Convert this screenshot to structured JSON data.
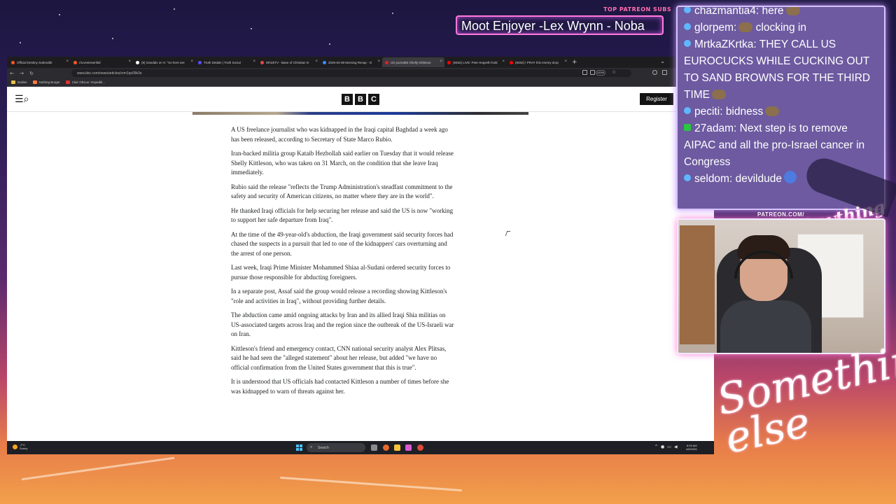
{
  "overlay": {
    "patreon_heading": "TOP PATREON SUBS",
    "patreon_ticker": "Moot Enjoyer -Lex Wrynn -  Noba",
    "patreon_url": "PATREON.COM/",
    "patreon_signature": "Anything else",
    "big_signature": "Something else"
  },
  "browser": {
    "tabs": [
      {
        "label": "Official Destiny Subreddit",
        "color": "#ff5722"
      },
      {
        "label": "r/Livestreamfail",
        "color": "#ff5722"
      },
      {
        "label": "(9) Gandalv on X: \"So here are",
        "color": "#ffffff"
      },
      {
        "label": "Truth Details | Truth Social",
        "color": "#5b4bff"
      },
      {
        "label": "WhickTV - Bane of Christian N",
        "color": "#e04a4a"
      },
      {
        "label": "2026-04-08 Morning Recap - G",
        "color": "#3d8bfd"
      },
      {
        "label": "US journalist Shelly Kittleson",
        "color": "#d22"
      },
      {
        "label": "(8452) LIVE: Pete Hegseth hold",
        "color": "#ff0000"
      },
      {
        "label": "(8452) I PRAY this enemy drop",
        "color": "#ff0000"
      }
    ],
    "url": "www.bbc.com/news/articles/crm1qx09k3o",
    "zoom": "120%",
    "bookmarks": [
      {
        "label": "Dailies",
        "color": "#e8c34a"
      },
      {
        "label": "Nothing Burger",
        "color": "#ff7a3d"
      },
      {
        "label": "Clair Obscur: Expediti...",
        "color": "#e03030"
      }
    ]
  },
  "bbc": {
    "logo": [
      "B",
      "B",
      "C"
    ],
    "register": "Register",
    "menu_icon": "☰",
    "search_icon": "⌕",
    "paragraphs": [
      "A US freelance journalist who was kidnapped in the Iraqi capital Baghdad a week ago has been released, according to Secretary of State Marco Rubio.",
      "Iran-backed militia group Kataib Hezbollah said earlier on Tuesday that it would release Shelly Kittleson, who was taken on 31 March, on the condition that she leave Iraq immediately.",
      "Rubio said the release \"reflects the Trump Administration's steadfast commitment to the safety and security of American citizens, no matter where they are in the world\".",
      "He thanked Iraqi officials for help securing her release and said the US is now \"working to support her safe departure from Iraq\".",
      "At the time of the 49-year-old's abduction, the Iraqi government said security forces had chased the suspects in a pursuit that led to one of the kidnappers' cars overturning and the arrest of one person.",
      "Last week, Iraqi Prime Minister Mohammed Shiaa al-Sudani ordered security forces to pursue those responsible for abducting foreigners.",
      "In a separate post, Assaf said the group would release a recording showing Kittleson's \"role and activities in Iraq\", without providing further details.",
      "The abduction came amid ongoing attacks by Iran and its allied Iraqi Shia militias on US-associated targets across Iraq and the region since the outbreak of the US-Israeli war on Iran.",
      "Kittleson's friend and emergency contact, CNN national security analyst Alex Plitsas, said he had seen the \"alleged statement\" about her release, but added \"we have no official confirmation from the United States government that this is true\".",
      "It is understood that US officials had contacted Kittleson a number of times before she was kidnapped to warn of threats against her."
    ]
  },
  "taskbar": {
    "weather_temp": "-2°C",
    "weather_desc": "Sunny",
    "search_placeholder": "Search",
    "time": "8:09 AM",
    "date": "4/8/2026"
  },
  "chat": {
    "messages": [
      {
        "user": "chazmantia4",
        "text": "here",
        "badge": "blue",
        "emote": true
      },
      {
        "user": "glorpem",
        "text": "clocking in",
        "badge": "blue",
        "emote": true,
        "emote_before": true
      },
      {
        "user": "MrtkaZKrtka",
        "text": "THEY CALL US EUROCUCKS WHILE CUCKING OUT TO SAND BROWNS FOR THE THIRD TIME",
        "badge": "blue",
        "emote": true
      },
      {
        "user": "peciti",
        "text": "bidness",
        "badge": "blue",
        "emote": true
      },
      {
        "user": "27adam",
        "text": "Next step is to remove AIPAC and all the pro-Israel cancer in Congress",
        "badge": "green",
        "emote": false
      },
      {
        "user": "seldom",
        "text": "devildude",
        "badge": "blue",
        "emote": true
      }
    ]
  }
}
